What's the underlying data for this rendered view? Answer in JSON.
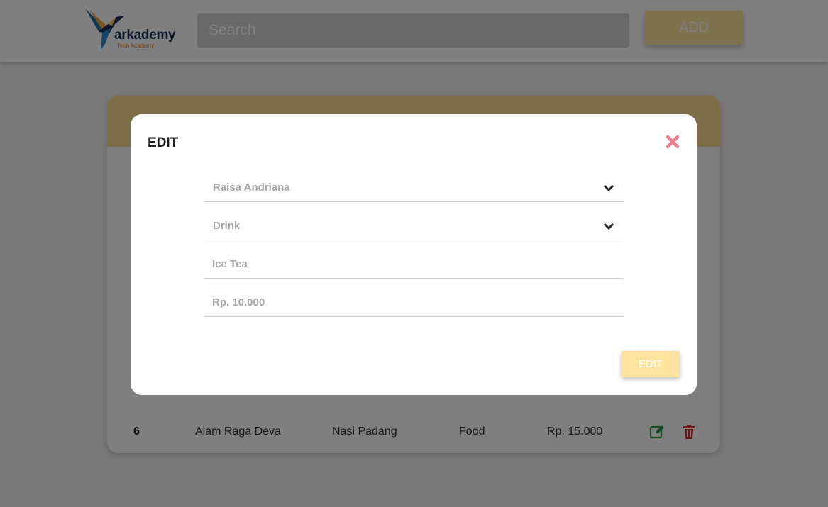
{
  "header": {
    "logo_text": "arkademy",
    "logo_subtext": "Tech Academy",
    "search_placeholder": "Search",
    "add_label": "ADD"
  },
  "table": {
    "row": {
      "no": "6",
      "cashier": "Alam Raga Deva",
      "product": "Nasi Padang",
      "category": "Food",
      "price": "Rp. 15.000"
    }
  },
  "modal": {
    "title": "EDIT",
    "cashier_value": "Raisa Andriana",
    "category_value": "Drink",
    "product_value": "Ice Tea",
    "price_value": "Rp. 10.000",
    "submit_label": "EDIT"
  },
  "icons": {
    "close": "close-icon",
    "dropdown": "chevron-down-icon",
    "edit": "edit-icon",
    "delete": "trash-icon"
  },
  "colors": {
    "accent": "#fcdb93",
    "button": "#fde39d",
    "close": "#f17c8a",
    "edit_icon": "#2e9c47",
    "delete_icon": "#d0322d",
    "brand_navy": "#1b2a55",
    "brand_orange": "#e0841b"
  }
}
